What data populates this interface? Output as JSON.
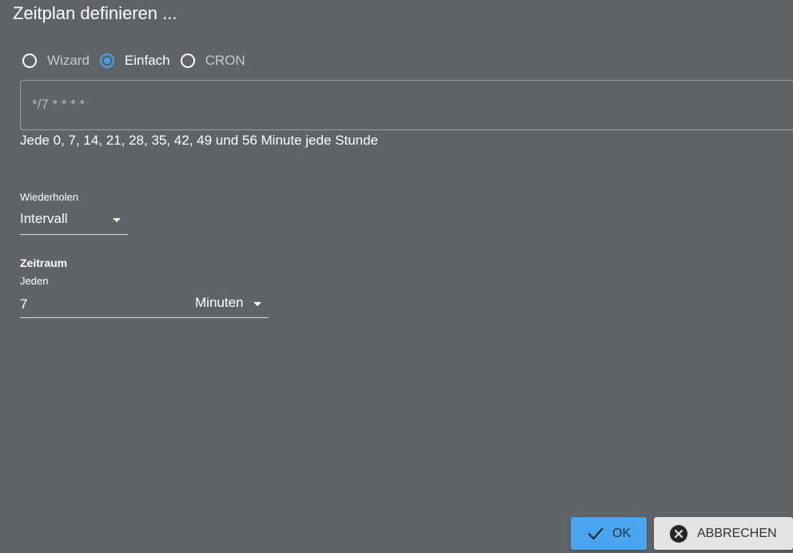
{
  "dialog": {
    "title": "Zeitplan definieren ..."
  },
  "mode": {
    "options": [
      {
        "label": "Wizard",
        "checked": false
      },
      {
        "label": "Einfach",
        "checked": true
      },
      {
        "label": "CRON",
        "checked": false
      }
    ]
  },
  "cron": {
    "value": "",
    "placeholder": "*/7 * * * *",
    "description": "Jede 0, 7, 14, 21, 28, 35, 42, 49 und 56 Minute jede Stunde"
  },
  "repeat": {
    "label": "Wiederholen",
    "value": "Intervall"
  },
  "period": {
    "heading": "Zeitraum",
    "every_label": "Jeden",
    "value": "7",
    "unit": "Minuten"
  },
  "buttons": {
    "ok_label": "OK",
    "cancel_label": "ABBRECHEN"
  },
  "colors": {
    "background": "#5f6469",
    "accent": "#42a5f5",
    "ok_button": "#4aa5f0",
    "cancel_button": "#e3e3e3"
  },
  "icons": {
    "ok": "check-icon",
    "cancel": "close-circle-icon",
    "dropdown": "caret-down-icon"
  }
}
